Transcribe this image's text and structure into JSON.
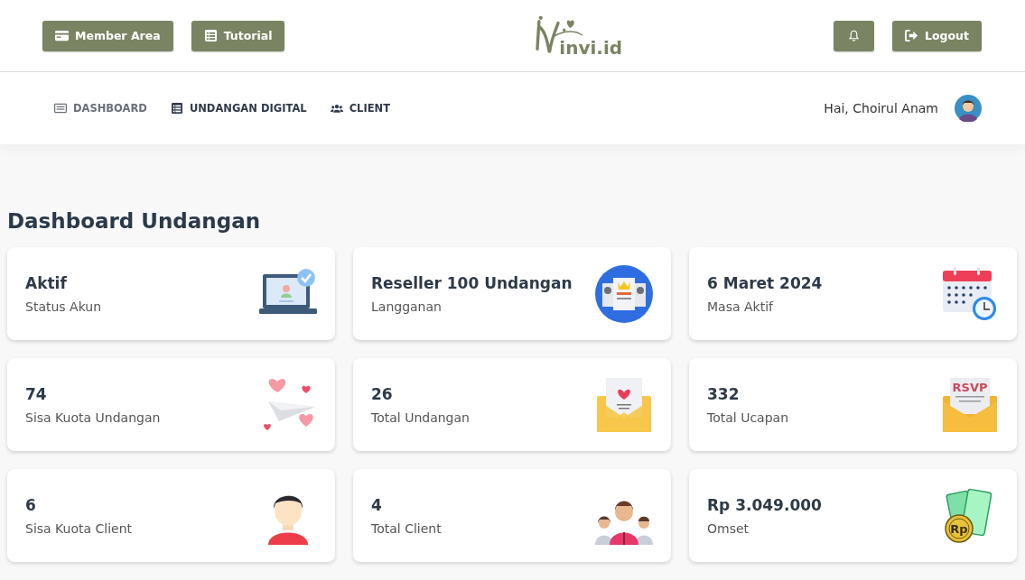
{
  "header": {
    "left_buttons": [
      {
        "label": "Member Area",
        "kind": "card"
      },
      {
        "label": "Tutorial",
        "kind": "list"
      }
    ],
    "logo": {
      "text": "invi.id"
    },
    "right_buttons": [
      {
        "kind": "bell"
      },
      {
        "label": "Logout",
        "kind": "logout"
      }
    ]
  },
  "nav": {
    "items": [
      {
        "label": "DASHBOARD",
        "kind": "card",
        "selected": true
      },
      {
        "label": "UNDANGAN DIGITAL",
        "kind": "list",
        "selected": false
      },
      {
        "label": "CLIENT",
        "kind": "users",
        "selected": false
      }
    ],
    "greeting": "Hai, Choirul Anam"
  },
  "page_title": "Dashboard Undangan",
  "cards": [
    {
      "value": "Aktif",
      "label": "Status Akun",
      "kind": "laptop"
    },
    {
      "value": "Reseller 100 Undangan",
      "label": "Langganan",
      "kind": "certificate"
    },
    {
      "value": "6 Maret 2024",
      "label": "Masa Aktif",
      "kind": "calendar"
    },
    {
      "value": "74",
      "label": "Sisa Kuota Undangan",
      "kind": "plane"
    },
    {
      "value": "26",
      "label": "Total Undangan",
      "kind": "envelope"
    },
    {
      "value": "332",
      "label": "Total Ucapan",
      "kind": "rsvp"
    },
    {
      "value": "6",
      "label": "Sisa Kuota Client",
      "kind": "person"
    },
    {
      "value": "4",
      "label": "Total Client",
      "kind": "group"
    },
    {
      "value": "Rp 3.049.000",
      "label": "Omset",
      "kind": "money"
    }
  ],
  "rsvp_icon_text": "RSVP",
  "money_icon_text": "Rp"
}
